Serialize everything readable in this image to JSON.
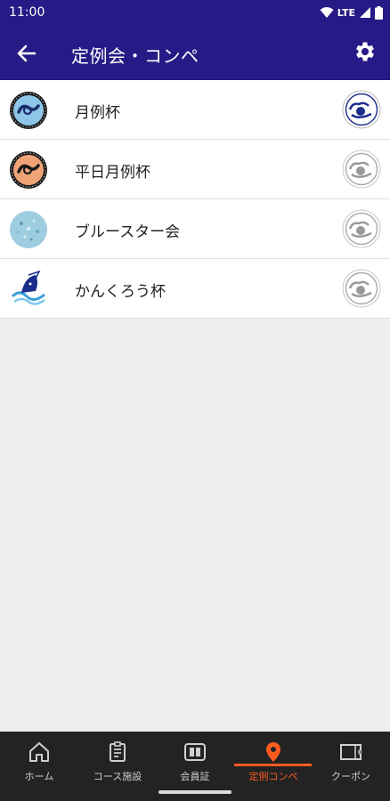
{
  "status_bar": {
    "time": "11:00",
    "network": "LTE"
  },
  "app_bar": {
    "title": "定例会・コンペ"
  },
  "list": [
    {
      "label": "月例杯",
      "logo": "blue-circle-emblem-icon",
      "badge_active": true
    },
    {
      "label": "平日月例杯",
      "logo": "orange-circle-emblem-icon",
      "badge_active": false
    },
    {
      "label": "ブルースター会",
      "logo": "speckled-blue-circle-icon",
      "badge_active": false
    },
    {
      "label": "かんくろう杯",
      "logo": "wave-bird-emblem-icon",
      "badge_active": false
    }
  ],
  "bottom_nav": {
    "items": [
      {
        "label": "ホーム",
        "icon": "home-icon"
      },
      {
        "label": "コース施設",
        "icon": "document-icon"
      },
      {
        "label": "会員証",
        "icon": "member-card-icon"
      },
      {
        "label": "定例コンペ",
        "icon": "location-pin-icon",
        "active": true
      },
      {
        "label": "クーポン",
        "icon": "coupon-icon"
      }
    ]
  },
  "colors": {
    "app_bar": "#271a86",
    "active": "#ff5a1f",
    "nav_bg": "#232323"
  }
}
